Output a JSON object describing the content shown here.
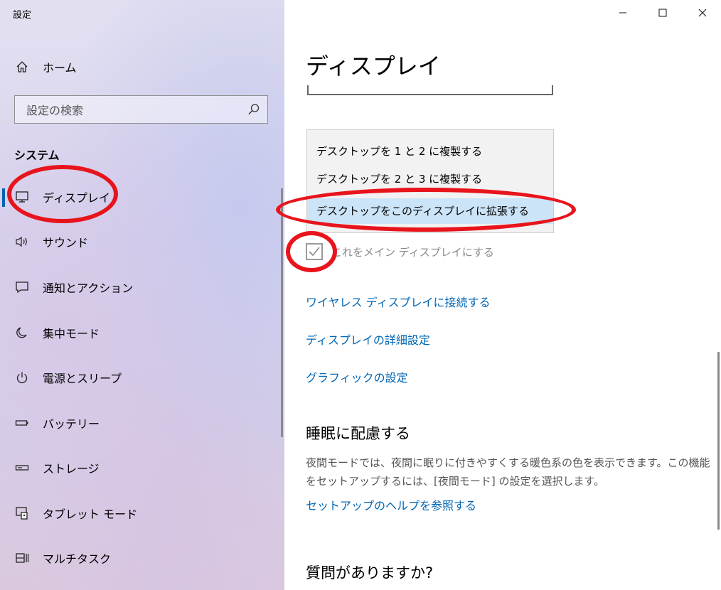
{
  "window": {
    "title": "設定",
    "minimize_icon": "minimize-icon",
    "maximize_icon": "maximize-icon",
    "close_icon": "close-icon"
  },
  "sidebar": {
    "home_label": "ホーム",
    "search_placeholder": "設定の検索",
    "section_label": "システム",
    "items": [
      {
        "label": "ディスプレイ",
        "icon": "monitor-icon",
        "selected": true
      },
      {
        "label": "サウンド",
        "icon": "speaker-icon"
      },
      {
        "label": "通知とアクション",
        "icon": "notification-icon"
      },
      {
        "label": "集中モード",
        "icon": "moon-icon"
      },
      {
        "label": "電源とスリープ",
        "icon": "power-icon"
      },
      {
        "label": "バッテリー",
        "icon": "battery-icon"
      },
      {
        "label": "ストレージ",
        "icon": "storage-icon"
      },
      {
        "label": "タブレット モード",
        "icon": "tablet-mode-icon"
      },
      {
        "label": "マルチタスク",
        "icon": "multitask-icon"
      }
    ]
  },
  "main": {
    "title": "ディスプレイ",
    "dropdown": {
      "options": [
        "デスクトップを 1 と 2 に複製する",
        "デスクトップを 2 と 3 に複製する",
        "デスクトップをこのディスプレイに拡張する"
      ],
      "selected_index": 2
    },
    "main_display_checkbox": {
      "label": "これをメイン ディスプレイにする",
      "checked": true,
      "disabled": true
    },
    "links": [
      "ワイヤレス ディスプレイに接続する",
      "ディスプレイの詳細設定",
      "グラフィックの設定"
    ],
    "sleep_section": {
      "title": "睡眠に配慮する",
      "description": "夜間モードでは、夜間に眠りに付きやすくする暖色系の色を表示できます。この機能をセットアップするには、[夜間モード] の設定を選択します。",
      "help_link": "セットアップのヘルプを参照する"
    },
    "questions_title": "質問がありますか?"
  },
  "colors": {
    "accent": "#0063b1",
    "link": "#0066b4",
    "annotation": "#e8141c",
    "selected_option": "#cce4f7"
  }
}
